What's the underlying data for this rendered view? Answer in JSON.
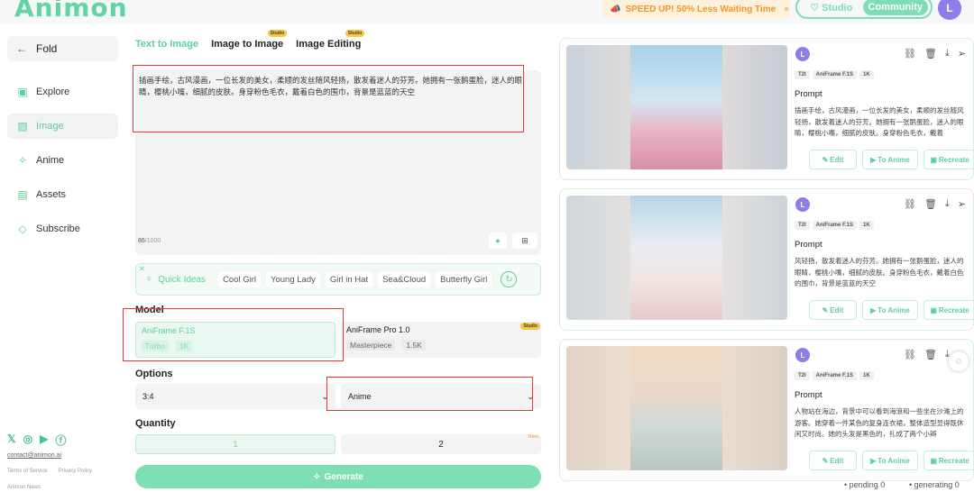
{
  "header": {
    "logo": "Animon",
    "banner_text": "SPEED UP! 50% Less Waiting Time",
    "banner_close": "×",
    "studio_label": "Studio",
    "community_label": "Community",
    "avatar_letter": "L"
  },
  "sidebar": {
    "fold_label": "Fold",
    "items": [
      {
        "label": "Explore",
        "icon": "explore-icon"
      },
      {
        "label": "Image",
        "icon": "image-icon"
      },
      {
        "label": "Anime",
        "icon": "sparkle-icon"
      },
      {
        "label": "Assets",
        "icon": "assets-icon"
      },
      {
        "label": "Subscribe",
        "icon": "diamond-icon"
      }
    ],
    "contact": "contact@animon.ai",
    "terms": "Terms of Service",
    "privacy": "Privacy Policy",
    "news": "Animon News"
  },
  "tabs": [
    {
      "label": "Text to Image",
      "tag": ""
    },
    {
      "label": "Image to Image",
      "tag": "Studio"
    },
    {
      "label": "Image Editing",
      "tag": "Studio"
    }
  ],
  "prompt": {
    "text": "插画手绘，古风漫画，一位长发的美女，柔顺的发丝随风轻扬，散发着迷人的芬芳。她拥有一张鹅蛋脸，迷人的眼睛，樱桃小嘴，细腻的皮肤。身穿粉色毛衣，戴着白色的围巾，背景是蓝蓝的天空",
    "count": "86",
    "max": "/1000"
  },
  "quick_ideas": {
    "label": "Quick Ideas",
    "chips": [
      "Cool Girl",
      "Young Lady",
      "Girl in Hat",
      "Sea&Cloud",
      "Butterfly Girl"
    ]
  },
  "model": {
    "label": "Model",
    "options": [
      {
        "name": "AniFrame F.1S",
        "tags": [
          "Turbo",
          "1K"
        ],
        "badge": ""
      },
      {
        "name": "AniFrame Pro 1.0",
        "tags": [
          "Masterpiece",
          "1.5K"
        ],
        "badge": "Studio"
      }
    ]
  },
  "options": {
    "label": "Options",
    "ratio": "3:4",
    "style": "Anime"
  },
  "quantity": {
    "label": "Quantity",
    "values": [
      "1",
      "2"
    ],
    "free_tag": "Renc"
  },
  "generate_label": "Generate",
  "results": [
    {
      "tags": [
        "T2I",
        "AniFrame F.1S",
        "1K"
      ],
      "prompt_title": "Prompt",
      "prompt_text": "插画手绘，古风漫画，一位长发的美女，柔顺的发丝随风轻扬，散发着迷人的芬芳。她拥有一张鹅蛋脸，迷人的眼睛，樱桃小嘴，细腻的皮肤。身穿粉色毛衣，戴着",
      "buttons": [
        "Edit",
        "To Anime",
        "Recreate"
      ]
    },
    {
      "tags": [
        "T2I",
        "AniFrame F.1S",
        "1K"
      ],
      "prompt_title": "Prompt",
      "prompt_text": "风轻扬，散发着迷人的芬芳。她拥有一张鹅蛋脸，迷人的眼睛，樱桃小嘴，细腻的皮肤。身穿粉色毛衣，戴着白色的围巾，背景是蓝蓝的天空",
      "buttons": [
        "Edit",
        "To Anime",
        "Recreate"
      ]
    },
    {
      "tags": [
        "T2I",
        "AniFrame F.1S",
        "1K"
      ],
      "prompt_title": "Prompt",
      "prompt_text": "人物站在海边，背景中可以看到海浪和一些坐在沙滩上的游客。她穿着一件某色的复身连衣裙，整体造型显得既休闲又时尚。她的头发是黑色的，扎成了两个小辫",
      "buttons": [
        "Edit",
        "To Anime",
        "Recreate"
      ]
    }
  ],
  "status": {
    "pending": "pending 0",
    "generating": "generating 0"
  },
  "colors": {
    "accent": "#5ccf9c",
    "avatar": "#8f7ce8",
    "banner": "#f0962b",
    "highlight": "#e53935"
  }
}
